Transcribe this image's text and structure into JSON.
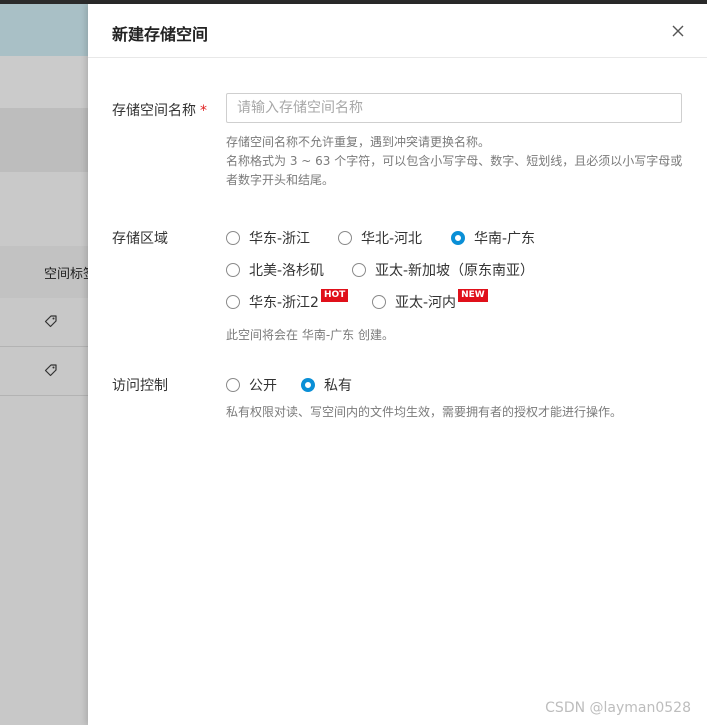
{
  "background_table": {
    "column_header": "空间标签",
    "rows": [
      {
        "icon": "tag-icon"
      },
      {
        "icon": "tag-icon"
      }
    ]
  },
  "drawer": {
    "title": "新建存储空间",
    "close_icon": "close-icon",
    "name_field": {
      "label": "存储空间名称",
      "required_mark": "*",
      "value": "",
      "placeholder": "请输入存储空间名称",
      "hint_line1": "存储空间名称不允许重复，遇到冲突请更换名称。",
      "hint_line2": "名称格式为 3 ~ 63 个字符，可以包含小写字母、数字、短划线，且必须以小写字母或",
      "hint_line3": "者数字开头和结尾。"
    },
    "region": {
      "label": "存储区域",
      "options": [
        {
          "label": "华东-浙江",
          "checked": false
        },
        {
          "label": "华北-河北",
          "checked": false
        },
        {
          "label": "华南-广东",
          "checked": true
        },
        {
          "label": "北美-洛杉矶",
          "checked": false
        },
        {
          "label": "亚太-新加坡（原东南亚）",
          "checked": false
        },
        {
          "label": "华东-浙江2",
          "checked": false,
          "badge": "HOT"
        },
        {
          "label": "亚太-河内",
          "checked": false,
          "badge": "NEW"
        }
      ],
      "note": "此空间将会在 华南-广东 创建。"
    },
    "access": {
      "label": "访问控制",
      "options": [
        {
          "label": "公开",
          "checked": false
        },
        {
          "label": "私有",
          "checked": true
        }
      ],
      "note": "私有权限对读、写空间内的文件均生效，需要拥有者的授权才能进行操作。"
    }
  },
  "colors": {
    "accent": "#0a8fd6",
    "badge_red": "#e0101a",
    "required": "#e02020"
  },
  "watermark": "CSDN @layman0528"
}
